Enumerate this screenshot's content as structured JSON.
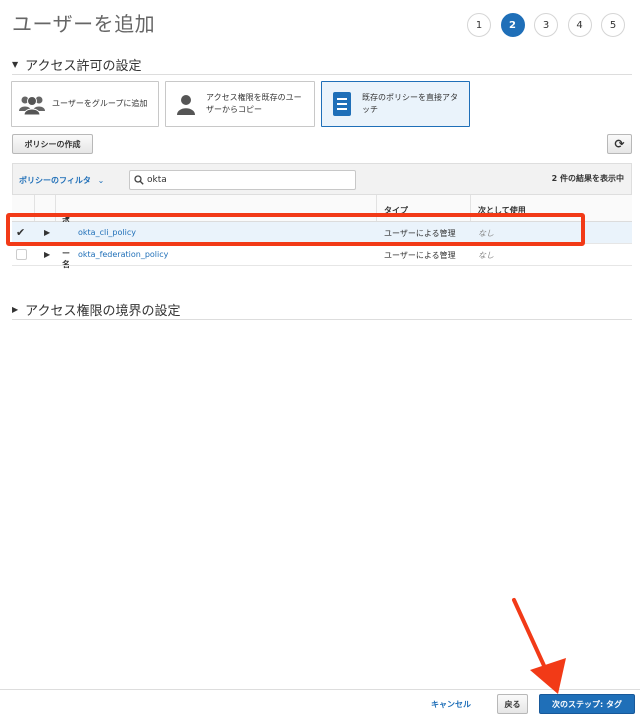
{
  "page": {
    "title": "ユーザーを追加"
  },
  "wizard": {
    "steps": [
      "1",
      "2",
      "3",
      "4",
      "5"
    ],
    "active_step": "2"
  },
  "access_section": {
    "title": "アクセス許可の設定"
  },
  "options": [
    {
      "label": "ユーザーをグループに追加",
      "icon": "group-icon",
      "selected": false
    },
    {
      "label": "アクセス権限を既存のユーザーからコピー",
      "icon": "user-icon",
      "selected": false
    },
    {
      "label": "既存のポリシーを直接アタッチ",
      "icon": "document-icon",
      "selected": true
    }
  ],
  "toolbar": {
    "create_policy_label": "ポリシーの作成",
    "refresh_icon": "refresh-icon"
  },
  "filter": {
    "label": "ポリシーのフィルタ",
    "search_value": "okta",
    "result_count": "2 件の結果を表示中"
  },
  "table": {
    "columns": [
      "ポリシー名",
      "タイプ",
      "次として使用"
    ],
    "rows": [
      {
        "name": "okta_cli_policy",
        "type": "ユーザーによる管理",
        "used_as": "なし",
        "checked": true
      },
      {
        "name": "okta_federation_policy",
        "type": "ユーザーによる管理",
        "used_as": "なし",
        "checked": false
      }
    ]
  },
  "boundary_section": {
    "title": "アクセス権限の境界の設定"
  },
  "footer": {
    "cancel_label": "キャンセル",
    "back_label": "戻る",
    "next_label": "次のステップ: タグ"
  },
  "colors": {
    "accent": "#1f6fb8",
    "highlight": "#f23a17"
  }
}
